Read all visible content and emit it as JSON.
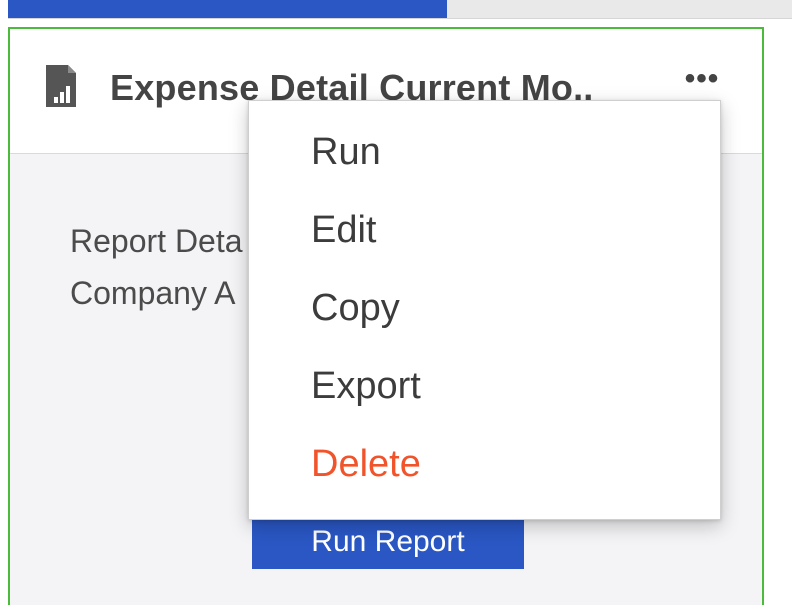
{
  "progress": {
    "fraction": 0.56,
    "fill_color": "#2a57c4"
  },
  "card": {
    "icon": "report-chart-icon",
    "title": "Expense Detail Current Mo..",
    "more_label": "•••",
    "border_color": "#4cbb3c",
    "description_line1": "Report Deta",
    "description_line2": "Company A",
    "run_report_label": "Run Report"
  },
  "context_menu": {
    "items": [
      {
        "label": "Run"
      },
      {
        "label": "Edit"
      },
      {
        "label": "Copy"
      },
      {
        "label": "Export"
      },
      {
        "label": "Delete",
        "color": "#f1532a"
      }
    ]
  }
}
